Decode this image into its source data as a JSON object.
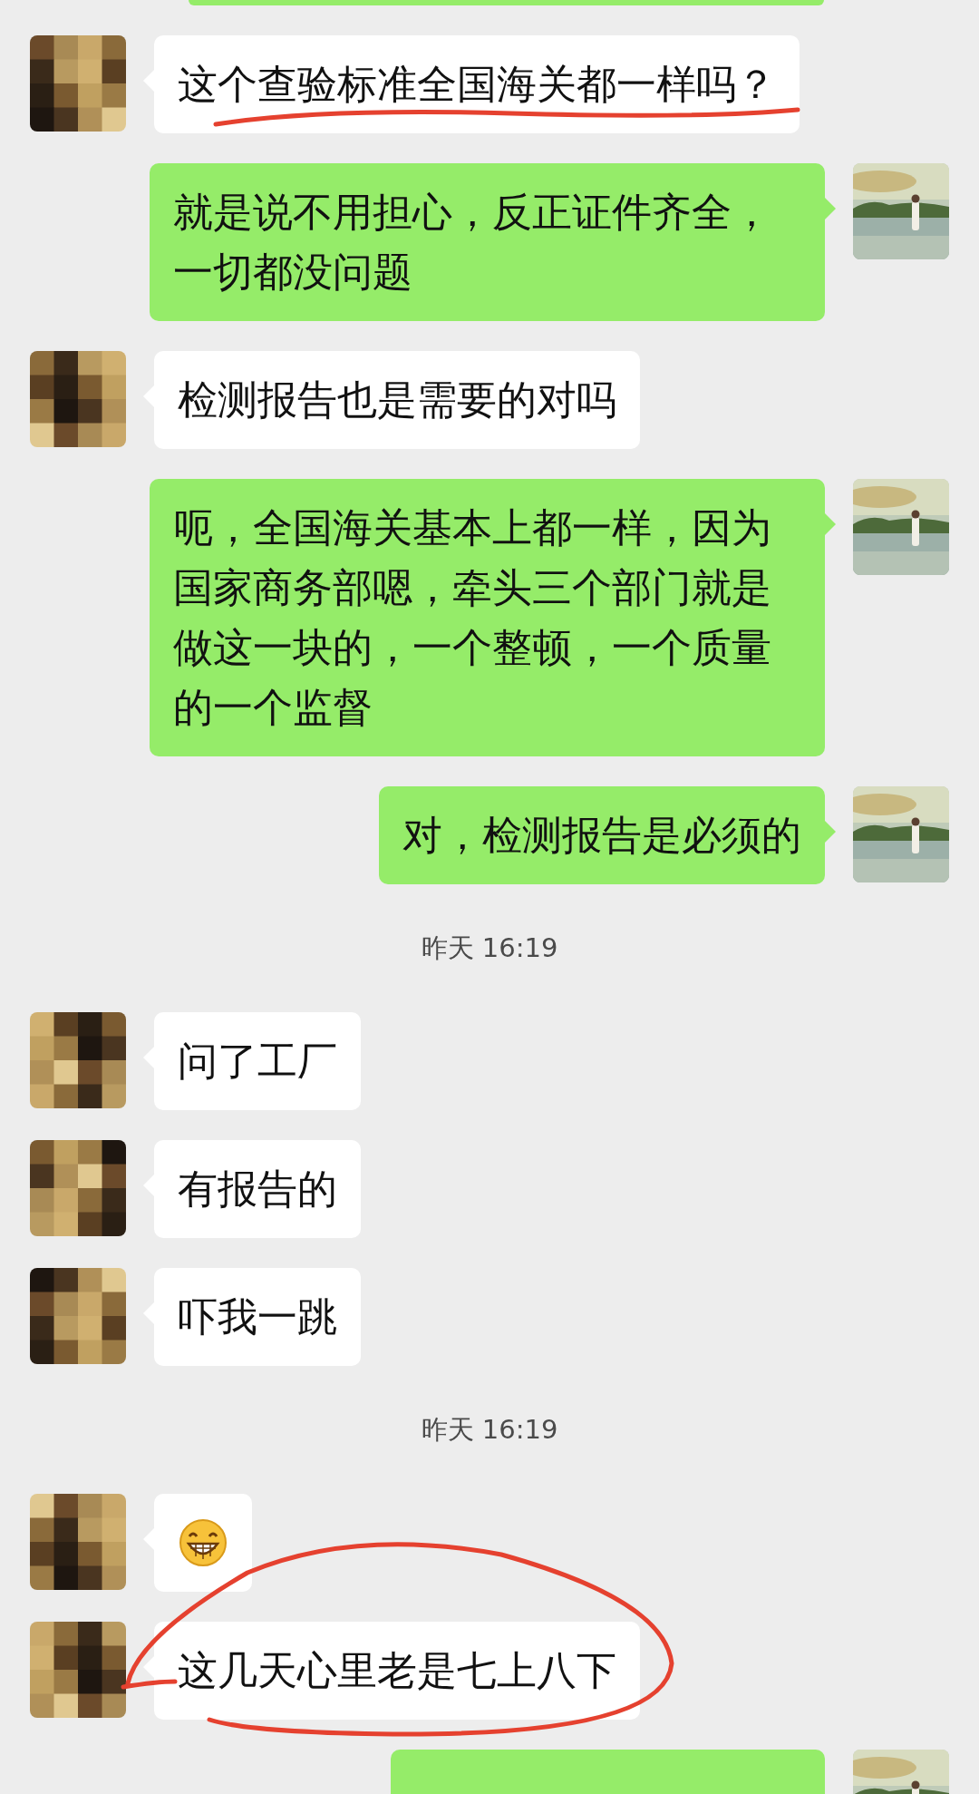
{
  "messages": [
    {
      "outgoing": true,
      "kind": "cut"
    },
    {
      "outgoing": false,
      "kind": "text",
      "text": "这个查验标准全国海关都一样吗？",
      "underlined": true,
      "circled": false
    },
    {
      "outgoing": true,
      "kind": "text",
      "text": "就是说不用担心，反正证件齐全，一切都没问题",
      "underlined": false,
      "circled": false
    },
    {
      "outgoing": false,
      "kind": "text",
      "text": "检测报告也是需要的对吗",
      "underlined": false,
      "circled": false
    },
    {
      "outgoing": true,
      "kind": "text",
      "text": "呃，全国海关基本上都一样，因为国家商务部嗯，牵头三个部门就是做这一块的，一个整顿，一个质量的一个监督",
      "underlined": false,
      "circled": false
    },
    {
      "outgoing": true,
      "kind": "text",
      "text": "对，检测报告是必须的",
      "underlined": false,
      "circled": false
    },
    {
      "kind": "time",
      "text": "昨天 16:19"
    },
    {
      "outgoing": false,
      "kind": "text",
      "text": "问了工厂",
      "underlined": false,
      "circled": false
    },
    {
      "outgoing": false,
      "kind": "text",
      "text": "有报告的",
      "underlined": false,
      "circled": false
    },
    {
      "outgoing": false,
      "kind": "text",
      "text": "吓我一跳",
      "underlined": false,
      "circled": false
    },
    {
      "kind": "time",
      "text": "昨天 16:19"
    },
    {
      "outgoing": false,
      "kind": "emoji"
    },
    {
      "outgoing": false,
      "kind": "text",
      "text": "这几天心里老是七上八下",
      "underlined": false,
      "circled": true
    },
    {
      "outgoing": true,
      "kind": "bottom"
    }
  ]
}
